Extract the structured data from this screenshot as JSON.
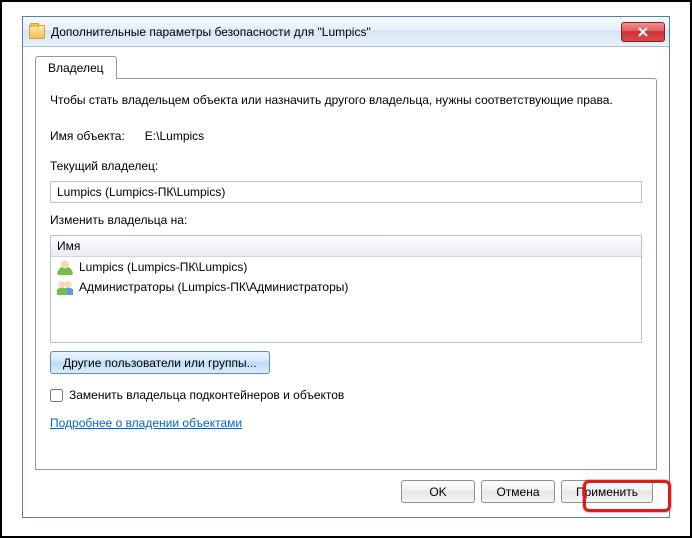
{
  "window": {
    "title": "Дополнительные параметры безопасности для \"Lumpics\""
  },
  "tab": {
    "owner": "Владелец"
  },
  "content": {
    "description": "Чтобы стать владельцем объекта или назначить другого владельца, нужны соответствующие права.",
    "object_label": "Имя объекта:",
    "object_value": "E:\\Lumpics",
    "current_owner_label": "Текущий владелец:",
    "current_owner_value": "Lumpics (Lumpics-ПК\\Lumpics)",
    "change_owner_label": "Изменить владельца на:",
    "list_header": "Имя",
    "owners": [
      {
        "name": "Lumpics (Lumpics-ПК\\Lumpics)",
        "type": "user"
      },
      {
        "name": "Администраторы (Lumpics-ПК\\Администраторы)",
        "type": "group"
      }
    ],
    "other_users_btn": "Другие пользователи или группы...",
    "replace_subcontainers": "Заменить владельца подконтейнеров и объектов",
    "learn_more": "Подробнее о владении объектами"
  },
  "buttons": {
    "ok": "OK",
    "cancel": "Отмена",
    "apply": "Применить"
  }
}
